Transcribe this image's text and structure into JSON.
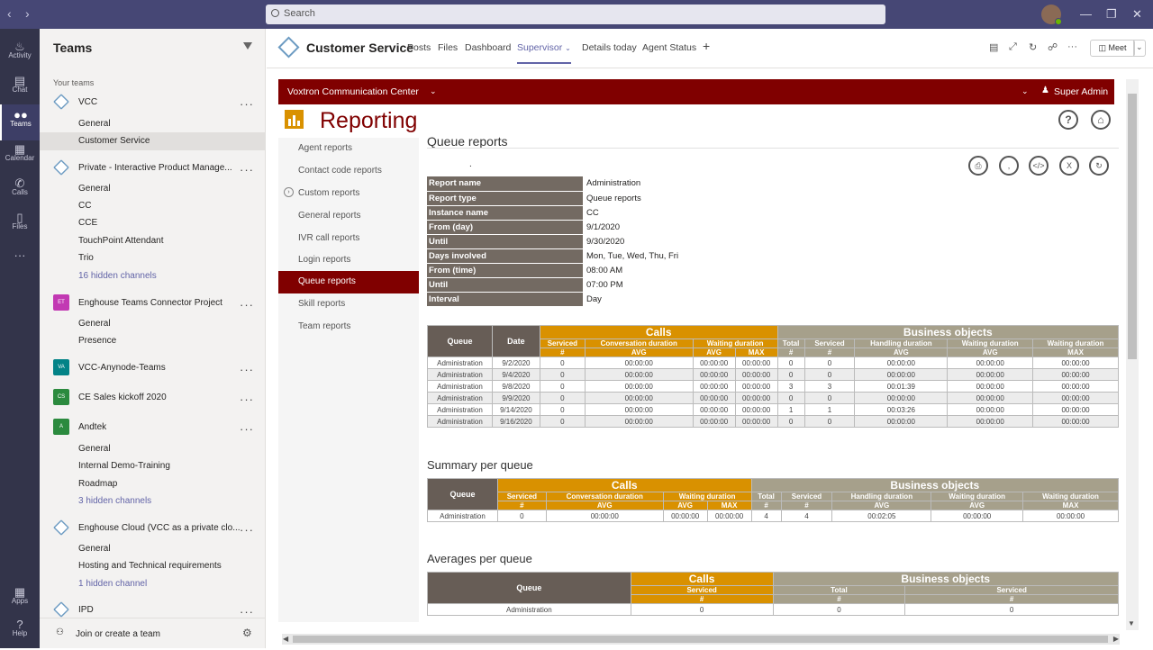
{
  "topbar": {
    "search_placeholder": "Search"
  },
  "rail": [
    {
      "label": "Activity",
      "icon": "bell-icon"
    },
    {
      "label": "Chat",
      "icon": "chat-icon"
    },
    {
      "label": "Teams",
      "icon": "teams-icon"
    },
    {
      "label": "Calendar",
      "icon": "calendar-icon"
    },
    {
      "label": "Calls",
      "icon": "phone-icon"
    },
    {
      "label": "Files",
      "icon": "files-icon"
    },
    {
      "label": "Apps",
      "icon": "apps-icon"
    },
    {
      "label": "Help",
      "icon": "help-icon"
    }
  ],
  "teams": {
    "title": "Teams",
    "section": "Your teams",
    "items": [
      {
        "label": "VCC",
        "type": "team"
      },
      {
        "label": "General",
        "type": "channel"
      },
      {
        "label": "Customer Service",
        "type": "channel",
        "selected": true
      },
      {
        "label": "Private - Interactive Product Manage...",
        "type": "team"
      },
      {
        "label": "General",
        "type": "channel"
      },
      {
        "label": "CC",
        "type": "channel"
      },
      {
        "label": "CCE",
        "type": "channel"
      },
      {
        "label": "TouchPoint Attendant",
        "type": "channel"
      },
      {
        "label": "Trio",
        "type": "channel"
      },
      {
        "label": "16 hidden channels",
        "type": "link"
      },
      {
        "label": "Enghouse Teams Connector Project",
        "type": "team",
        "badge": "ET"
      },
      {
        "label": "General",
        "type": "channel"
      },
      {
        "label": "Presence",
        "type": "channel"
      },
      {
        "label": "VCC-Anynode-Teams",
        "type": "team",
        "badge": "VA"
      },
      {
        "label": "CE Sales kickoff 2020",
        "type": "team",
        "badge": "CS"
      },
      {
        "label": "Andtek",
        "type": "team",
        "badge": "A"
      },
      {
        "label": "General",
        "type": "channel"
      },
      {
        "label": "Internal Demo-Training",
        "type": "channel"
      },
      {
        "label": "Roadmap",
        "type": "channel"
      },
      {
        "label": "3 hidden channels",
        "type": "link"
      },
      {
        "label": "Enghouse Cloud (VCC as a private clo...",
        "type": "team"
      },
      {
        "label": "General",
        "type": "channel"
      },
      {
        "label": "Hosting and Technical requirements",
        "type": "channel"
      },
      {
        "label": "1 hidden channel",
        "type": "link"
      },
      {
        "label": "IPD",
        "type": "team"
      }
    ],
    "join_label": "Join or create a team"
  },
  "header": {
    "title": "Customer Service",
    "tabs": [
      "Posts",
      "Files",
      "Dashboard",
      "Supervisor",
      "Details today",
      "Agent Status"
    ],
    "active_tab": "Supervisor",
    "meet_label": "Meet"
  },
  "app": {
    "center_name": "Voxtron Communication Center",
    "user": "Super Admin",
    "title": "Reporting",
    "nav": [
      "Agent reports",
      "Contact code reports",
      "Custom reports",
      "General reports",
      "IVR call reports",
      "Login reports",
      "Queue reports",
      "Skill reports",
      "Team reports"
    ],
    "active_nav": "Queue reports",
    "page_title": "Queue reports",
    "dot": "."
  },
  "info": [
    [
      "Report name",
      "Administration"
    ],
    [
      "Report type",
      "Queue reports"
    ],
    [
      "Instance name",
      "CC"
    ],
    [
      "From (day)",
      "9/1/2020"
    ],
    [
      "Until",
      "9/30/2020"
    ],
    [
      "Days involved",
      "Mon, Tue, Wed, Thu, Fri"
    ],
    [
      "From (time)",
      "08:00 AM"
    ],
    [
      "Until",
      "07:00 PM"
    ],
    [
      "Interval",
      "Day"
    ]
  ],
  "table1": {
    "h_queue": "Queue",
    "h_date": "Date",
    "h_calls": "Calls",
    "h_bo": "Business objects",
    "sub": [
      "Serviced",
      "Conversation duration",
      "Waiting duration",
      "Total",
      "Serviced",
      "Handling duration",
      "Waiting duration",
      "Waiting duration"
    ],
    "sub2": [
      "#",
      "AVG",
      "AVG",
      "MAX",
      "#",
      "#",
      "AVG",
      "AVG",
      "MAX"
    ],
    "rows": [
      [
        "Administration",
        "9/2/2020",
        "0",
        "00:00:00",
        "00:00:00",
        "00:00:00",
        "0",
        "0",
        "00:00:00",
        "00:00:00",
        "00:00:00"
      ],
      [
        "Administration",
        "9/4/2020",
        "0",
        "00:00:00",
        "00:00:00",
        "00:00:00",
        "0",
        "0",
        "00:00:00",
        "00:00:00",
        "00:00:00"
      ],
      [
        "Administration",
        "9/8/2020",
        "0",
        "00:00:00",
        "00:00:00",
        "00:00:00",
        "3",
        "3",
        "00:01:39",
        "00:00:00",
        "00:00:00"
      ],
      [
        "Administration",
        "9/9/2020",
        "0",
        "00:00:00",
        "00:00:00",
        "00:00:00",
        "0",
        "0",
        "00:00:00",
        "00:00:00",
        "00:00:00"
      ],
      [
        "Administration",
        "9/14/2020",
        "0",
        "00:00:00",
        "00:00:00",
        "00:00:00",
        "1",
        "1",
        "00:03:26",
        "00:00:00",
        "00:00:00"
      ],
      [
        "Administration",
        "9/16/2020",
        "0",
        "00:00:00",
        "00:00:00",
        "00:00:00",
        "0",
        "0",
        "00:00:00",
        "00:00:00",
        "00:00:00"
      ]
    ]
  },
  "summary": {
    "title": "Summary per queue",
    "row": [
      "Administration",
      "0",
      "00:00:00",
      "00:00:00",
      "00:00:00",
      "4",
      "4",
      "00:02:05",
      "00:00:00",
      "00:00:00"
    ]
  },
  "averages": {
    "title": "Averages per queue",
    "h_serviced": "Serviced",
    "h_total": "Total",
    "row": [
      "Administration",
      "0",
      "0",
      "0"
    ]
  }
}
